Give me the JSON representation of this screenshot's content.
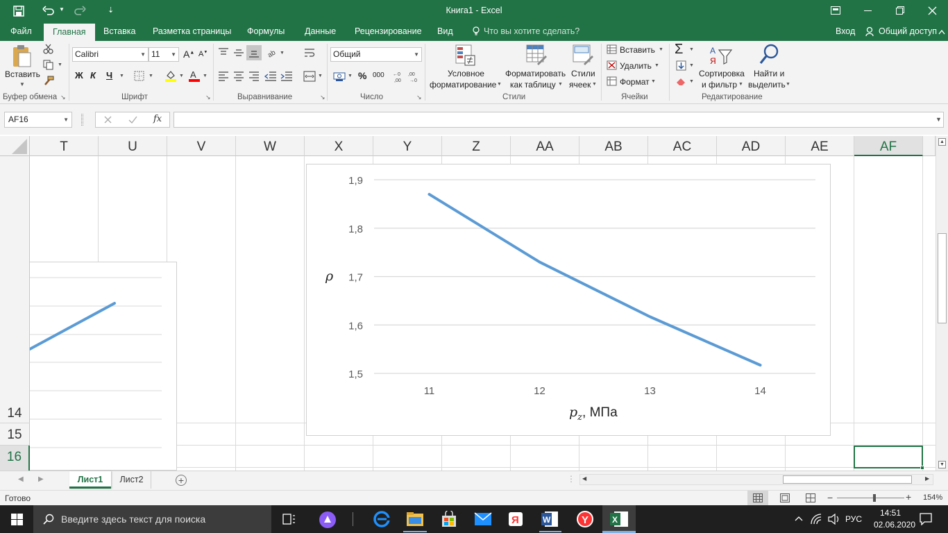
{
  "window": {
    "title": "Книга1 - Excel"
  },
  "ribbon_tabs": [
    "Файл",
    "Главная",
    "Вставка",
    "Разметка страницы",
    "Формулы",
    "Данные",
    "Рецензирование",
    "Вид"
  ],
  "tell_me": "Что вы хотите сделать?",
  "account": {
    "login": "Вход",
    "share": "Общий доступ"
  },
  "ribbon": {
    "clipboard": {
      "paste": "Вставить",
      "label": "Буфер обмена"
    },
    "font": {
      "name": "Calibri",
      "size": "11",
      "bold": "Ж",
      "italic": "К",
      "underline": "Ч",
      "label": "Шрифт"
    },
    "alignment": {
      "label": "Выравнивание"
    },
    "number": {
      "format": "Общий",
      "percent": "%",
      "thousands": "000",
      "label": "Число"
    },
    "styles": {
      "cond_line1": "Условное",
      "cond_line2": "форматирование",
      "table_line1": "Форматировать",
      "table_line2": "как таблицу",
      "cell_line1": "Стили",
      "cell_line2": "ячеек",
      "label": "Стили"
    },
    "cells": {
      "insert": "Вставить",
      "delete": "Удалить",
      "format": "Формат",
      "label": "Ячейки"
    },
    "editing": {
      "sort_line1": "Сортировка",
      "sort_line2": "и фильтр",
      "find_line1": "Найти и",
      "find_line2": "выделить",
      "label": "Редактирование"
    }
  },
  "formula_bar": {
    "name_box": "AF16",
    "fx": "fx",
    "value": ""
  },
  "columns": [
    "T",
    "U",
    "V",
    "W",
    "X",
    "Y",
    "Z",
    "AA",
    "AB",
    "AC",
    "AD",
    "AE",
    "AF"
  ],
  "rows": [
    "14",
    "15",
    "16"
  ],
  "selected_cell": "AF16",
  "sheets": [
    "Лист1",
    "Лист2"
  ],
  "active_sheet": "Лист1",
  "status": {
    "ready": "Готово",
    "zoom": "154%"
  },
  "taskbar": {
    "search_placeholder": "Введите здесь текст для поиска",
    "lang": "РУС",
    "time": "14:51",
    "date": "02.06.2020"
  },
  "colors": {
    "accent": "#217346",
    "series": "#5b9bd5"
  },
  "chart_data": [
    {
      "type": "line",
      "x": [
        11,
        12,
        13,
        14
      ],
      "series": [
        {
          "values": [
            1.87,
            1.73,
            1.617,
            1.517
          ]
        }
      ],
      "xlabel": "p_z, МПа",
      "ylabel": "ρ",
      "x_ticks": [
        "11",
        "12",
        "13",
        "14"
      ],
      "y_ticks": [
        "1,5",
        "1,6",
        "1,7",
        "1,8",
        "1,9"
      ],
      "ylim": [
        1.5,
        1.9
      ],
      "grid": "horizontal"
    }
  ]
}
